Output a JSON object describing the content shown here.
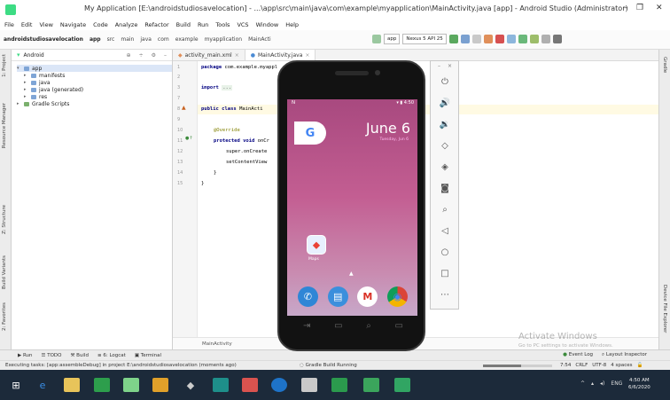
{
  "window": {
    "title": "My Application [E:\\androidstudiosavelocation] - ...\\app\\src\\main\\java\\com\\example\\myapplication\\MainActivity.java [app] - Android Studio (Administrator)",
    "minimize": "–",
    "maximize": "❐"
  },
  "menu": [
    "File",
    "Edit",
    "View",
    "Navigate",
    "Code",
    "Analyze",
    "Refactor",
    "Build",
    "Run",
    "Tools",
    "VCS",
    "Window",
    "Help"
  ],
  "breadcrumbs": [
    "androidstudiosavelocation",
    "app",
    "src",
    "main",
    "java",
    "com",
    "example",
    "myapplication",
    "MainActi"
  ],
  "toolbar": {
    "config": "app",
    "device": "Nexus 5 API 25"
  },
  "project_panel": {
    "view": "Android",
    "tree": [
      {
        "label": "app",
        "level": 0
      },
      {
        "label": "manifests",
        "level": 1
      },
      {
        "label": "java",
        "level": 1
      },
      {
        "label": "java (generated)",
        "level": 1
      },
      {
        "label": "res",
        "level": 1
      },
      {
        "label": "Gradle Scripts",
        "level": 0
      }
    ]
  },
  "left_strip": [
    "1: Project",
    "Resource Manager",
    "Z: Structure",
    "Build Variants",
    "2: Favorites"
  ],
  "right_strip": [
    "Gradle",
    "Device File Explorer"
  ],
  "editor_tabs": [
    "activity_main.xml",
    "MainActivity.java"
  ],
  "code": {
    "line_numbers": [
      "1",
      "2",
      "3",
      "7",
      "8",
      "9",
      "10",
      "11",
      "12",
      "13",
      "14",
      "15"
    ],
    "package_kw": "package",
    "package_rest": "com.example.myappl",
    "import_kw": "import",
    "import_fold": "...",
    "class_kw": "public class",
    "class_rest": "MainActi",
    "override": "@Override",
    "method_kw": "protected void",
    "method_rest": "onCr",
    "super_call": "super.onCreate",
    "set_content": "setContentView",
    "close_brace_1": "}",
    "close_brace_2": "}",
    "footer_crumb": "MainActivity"
  },
  "emulator": {
    "status_left": "N",
    "status_time": "4:50",
    "google_letter": "G",
    "date": "June 6",
    "date_sub": "Tuesday, Jun 6",
    "maps_label": "Maps",
    "dock": [
      "phone",
      "messages",
      "gmail",
      "chrome"
    ],
    "dock_glyphs": [
      "✆",
      "▤",
      "M",
      "◉"
    ],
    "nav": [
      "⇥",
      "▭",
      "⌕",
      "▭"
    ]
  },
  "emulator_panel": {
    "top": [
      "–",
      "×"
    ],
    "buttons": [
      "power",
      "volume-up",
      "volume-down",
      "rotate-left",
      "rotate-right",
      "camera",
      "zoom",
      "back",
      "home",
      "overview",
      "more"
    ],
    "glyphs": [
      "⏻",
      "🔊",
      "🔉",
      "◇",
      "◈",
      "◙",
      "⌕",
      "◁",
      "○",
      "□",
      "⋯"
    ]
  },
  "bottom_tabs": [
    "Run",
    "TODO",
    "Build",
    "6: Logcat",
    "Terminal"
  ],
  "bottom_tabs_right": [
    "Event Log",
    "Layout Inspector"
  ],
  "status": {
    "message": "Executing tasks: [app:assembleDebug] in project E:\\androidstudiosavelocation (moments ago)",
    "gradle": "Gradle Build Running",
    "progress_percent": 55,
    "right": [
      "7:54",
      "CRLF",
      "UTF-8",
      "4 spaces"
    ]
  },
  "watermark": {
    "title": "Activate Windows",
    "sub": "Go to PC settings to activate Windows."
  },
  "taskbar": {
    "icons": [
      "windows",
      "edge",
      "explorer",
      "store",
      "android-studio",
      "chrome",
      "player",
      "mail",
      "app",
      "java",
      "word",
      "terminal",
      "app2"
    ],
    "tray": [
      "ENG"
    ],
    "time": "4:50 AM",
    "date": "6/6/2020"
  },
  "colors": {
    "accent": "#3ddc84",
    "wallpaper_top": "#a8497f",
    "taskbar": "#1c2a3a"
  }
}
